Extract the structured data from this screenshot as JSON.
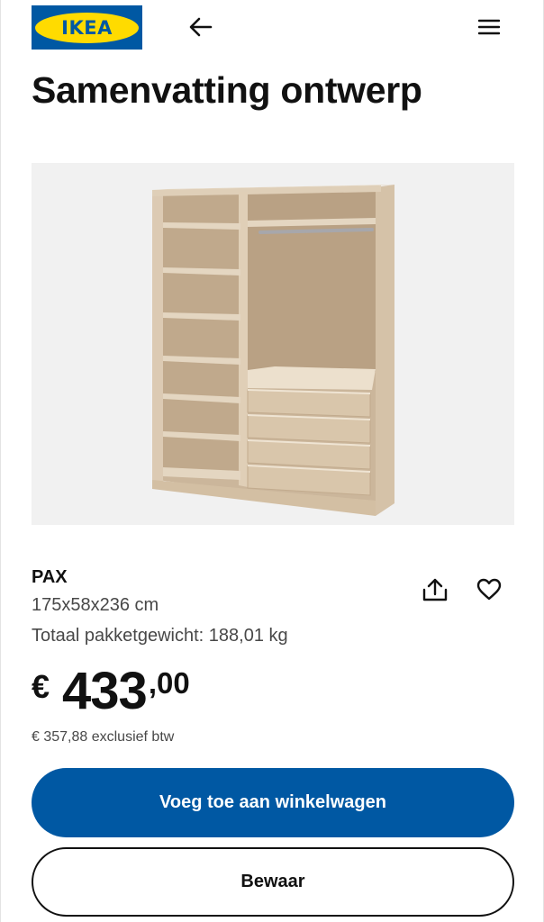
{
  "header": {
    "logo_text": "IKEA",
    "back_icon": "arrow-left-icon",
    "menu_icon": "hamburger-menu-icon"
  },
  "page_title": "Samenvatting ontwerp",
  "product": {
    "name": "PAX",
    "dimensions": "175x58x236 cm",
    "weight": "Totaal pakketgewicht: 188,01 kg",
    "price": {
      "currency": "€",
      "integer": "433",
      "decimal": ",00"
    },
    "price_excl_vat": "€ 357,88 exclusief btw",
    "actions": {
      "share_icon": "share-upload-icon",
      "favorite_icon": "heart-icon"
    }
  },
  "buttons": {
    "add_to_cart": "Voeg toe aan winkelwagen",
    "save": "Bewaar"
  },
  "colors": {
    "brand_blue": "#0058a3",
    "brand_yellow": "#ffdb00",
    "image_background": "#f1f1f1"
  }
}
